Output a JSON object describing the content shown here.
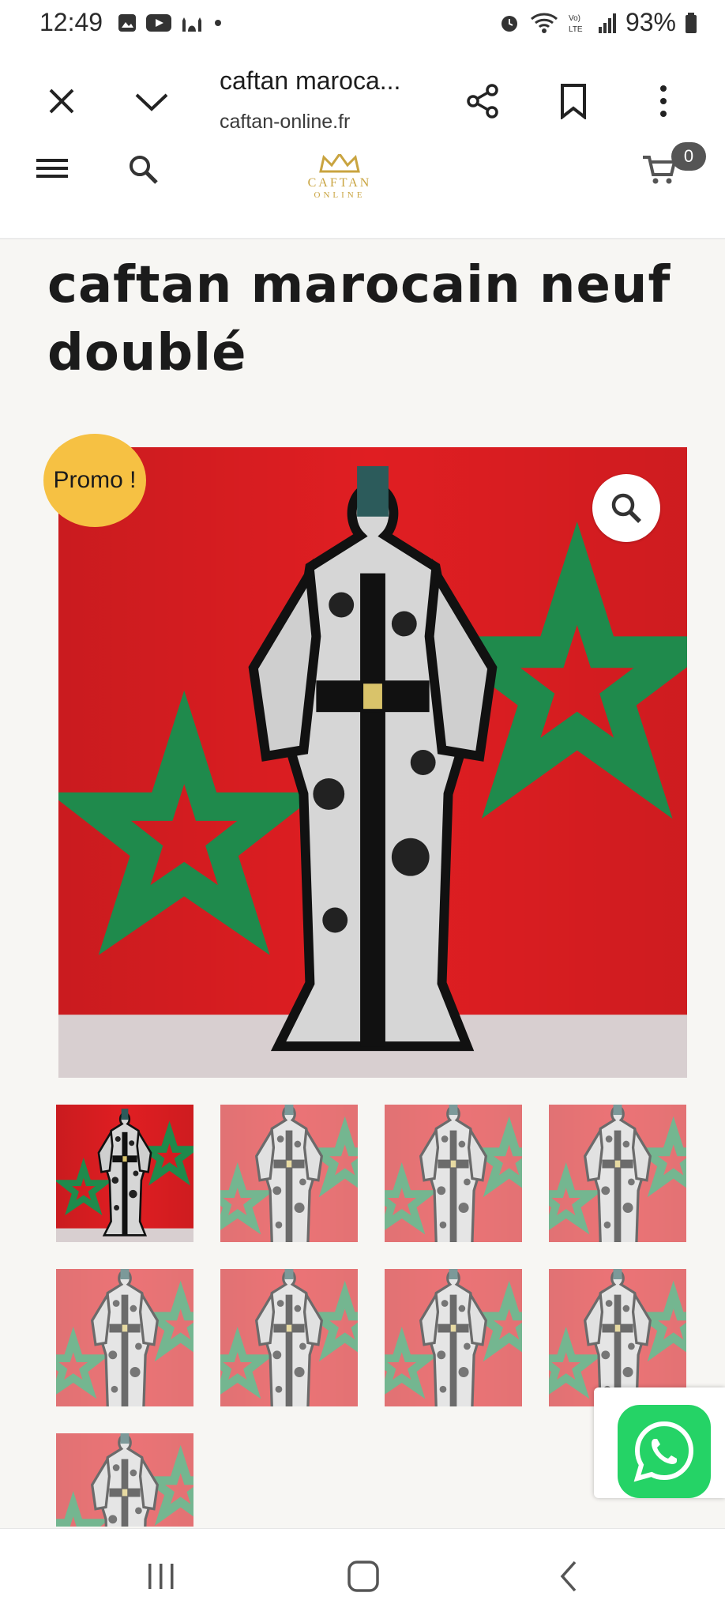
{
  "status_bar": {
    "time": "12:49",
    "battery": "93%"
  },
  "browser": {
    "title": "caftan maroca...",
    "url": "caftan-online.fr"
  },
  "site": {
    "logo_line1": "CAFTAN",
    "logo_line2": "ONLINE",
    "cart_count": "0"
  },
  "product": {
    "title": "caftan marocain neuf doublé",
    "promo_badge": "Promo !",
    "thumbnail_count": 9
  },
  "colors": {
    "flag_red": "#e01e22",
    "star_green": "#1f8a4c",
    "promo_yellow": "#f6c143",
    "whatsapp_green": "#25d366"
  }
}
